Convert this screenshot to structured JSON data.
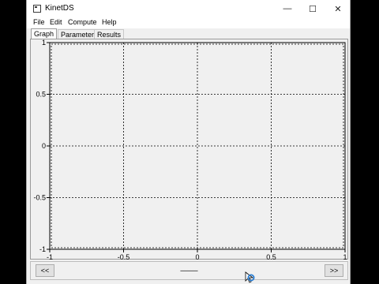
{
  "window": {
    "title": "KinetDS",
    "icon": "app-window-icon",
    "controls": {
      "minimize": "—",
      "maximize": "☐",
      "close": "✕"
    }
  },
  "menu": {
    "items": [
      "File",
      "Edit",
      "Compute",
      "Help"
    ]
  },
  "tabs": [
    {
      "label": "Graph",
      "active": true
    },
    {
      "label": "Parameters",
      "active": false
    },
    {
      "label": "Results",
      "active": false
    }
  ],
  "chart_data": {
    "type": "scatter",
    "title": "",
    "xlabel": "",
    "ylabel": "",
    "xlim": [
      -1,
      1
    ],
    "ylim": [
      -1,
      1
    ],
    "xticks": [
      "-1",
      "-0.5",
      "0",
      "0.5",
      "1"
    ],
    "yticks": [
      "1",
      "0.5",
      "0",
      "-0.5",
      "-1"
    ],
    "grid": true,
    "grid_style": "dotted",
    "series": []
  },
  "navigation": {
    "prev_label": "<<",
    "next_label": ">>",
    "status": "-----------"
  },
  "colors": {
    "window_bg": "#f0f0f0",
    "grid": "#000000",
    "cursor_ring": "#2b7fd4"
  }
}
